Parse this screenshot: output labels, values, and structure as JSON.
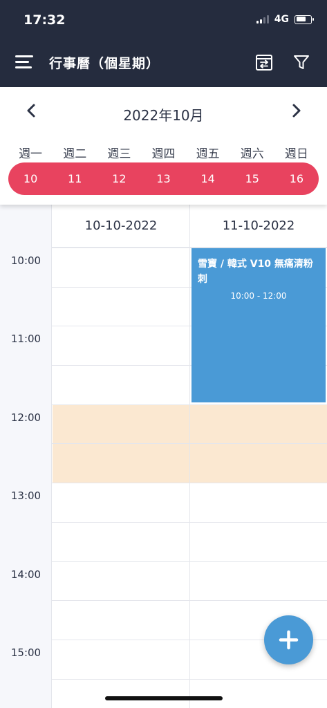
{
  "status": {
    "time": "17:32",
    "network": "4G"
  },
  "header": {
    "title": "行事曆（個星期）",
    "menu_icon": "hamburger-icon",
    "switch_icon": "switch-view-icon",
    "filter_icon": "filter-icon"
  },
  "calendar": {
    "month_title": "2022年10月",
    "weekdays": [
      "週一",
      "週二",
      "週三",
      "週四",
      "週五",
      "週六",
      "週日"
    ],
    "dates": [
      "10",
      "11",
      "12",
      "13",
      "14",
      "15",
      "16"
    ],
    "accent_color": "#e8435f"
  },
  "grid": {
    "columns": [
      "10-10-2022",
      "11-10-2022"
    ],
    "times": [
      "10:00",
      "11:00",
      "12:00",
      "13:00",
      "14:00",
      "15:00"
    ]
  },
  "event": {
    "title": "雪寶 / 韓式 V10 無痛清粉刺",
    "time": "10:00 - 12:00",
    "color": "#4a9ad6"
  },
  "fab": {
    "icon": "plus-icon"
  }
}
